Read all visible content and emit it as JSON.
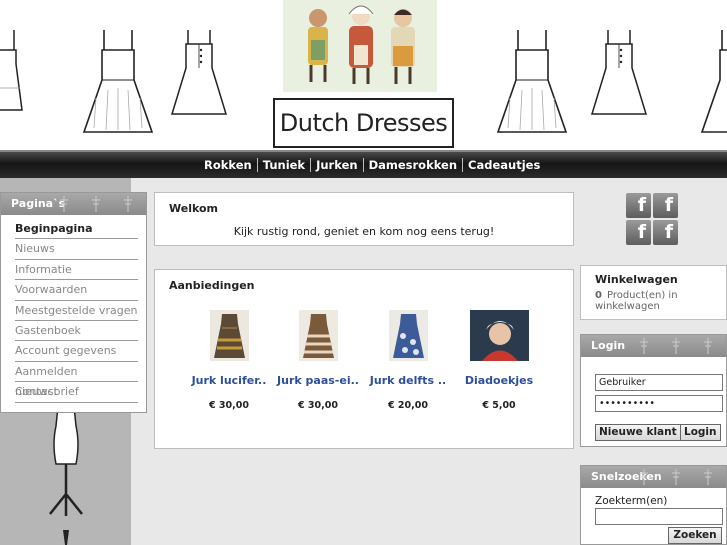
{
  "header": {
    "logo_text": "Dutch Dresses"
  },
  "nav": {
    "items": [
      "Rokken",
      "Tuniek",
      "Jurken",
      "Damesrokken",
      "Cadeautjes"
    ]
  },
  "sidebar": {
    "title": "Pagina`s",
    "items": [
      {
        "label": "Beginpagina",
        "active": true
      },
      {
        "label": "Nieuws"
      },
      {
        "label": "Informatie"
      },
      {
        "label": "Voorwaarden"
      },
      {
        "label": "Meestgestelde vragen"
      },
      {
        "label": "Gastenboek"
      },
      {
        "label": "Account gegevens"
      },
      {
        "label": "Aanmelden nieuwsbrief"
      },
      {
        "label": "Contact"
      }
    ]
  },
  "welcome": {
    "title": "Welkom",
    "text": "Kijk rustig rond, geniet en kom nog eens terug!"
  },
  "offers": {
    "title": "Aanbiedingen",
    "products": [
      {
        "name": "Jurk lucifer..",
        "price": "€ 30,00"
      },
      {
        "name": "Jurk paas-ei..",
        "price": "€ 30,00"
      },
      {
        "name": "Jurk delfts ..",
        "price": "€ 20,00"
      },
      {
        "name": "Diadoekjes",
        "price": "€ 5,00"
      }
    ]
  },
  "social": {
    "icon": "facebook-icon",
    "glyph": "f"
  },
  "cart": {
    "title": "Winkelwagen",
    "count": "0",
    "text": "Product(en) in winkelwagen"
  },
  "login": {
    "title": "Login",
    "username_value": "Gebruiker",
    "password_value": "••••••••••",
    "new_customer_label": "Nieuwe klant",
    "login_label": "Login"
  },
  "quicksearch": {
    "title": "Snelzoeken",
    "label": "Zoekterm(en)",
    "button_label": "Zoeken"
  },
  "colors": {
    "nav_bg": "#1e1e1e",
    "link": "#2d4f9a",
    "box_header": "#999999"
  }
}
